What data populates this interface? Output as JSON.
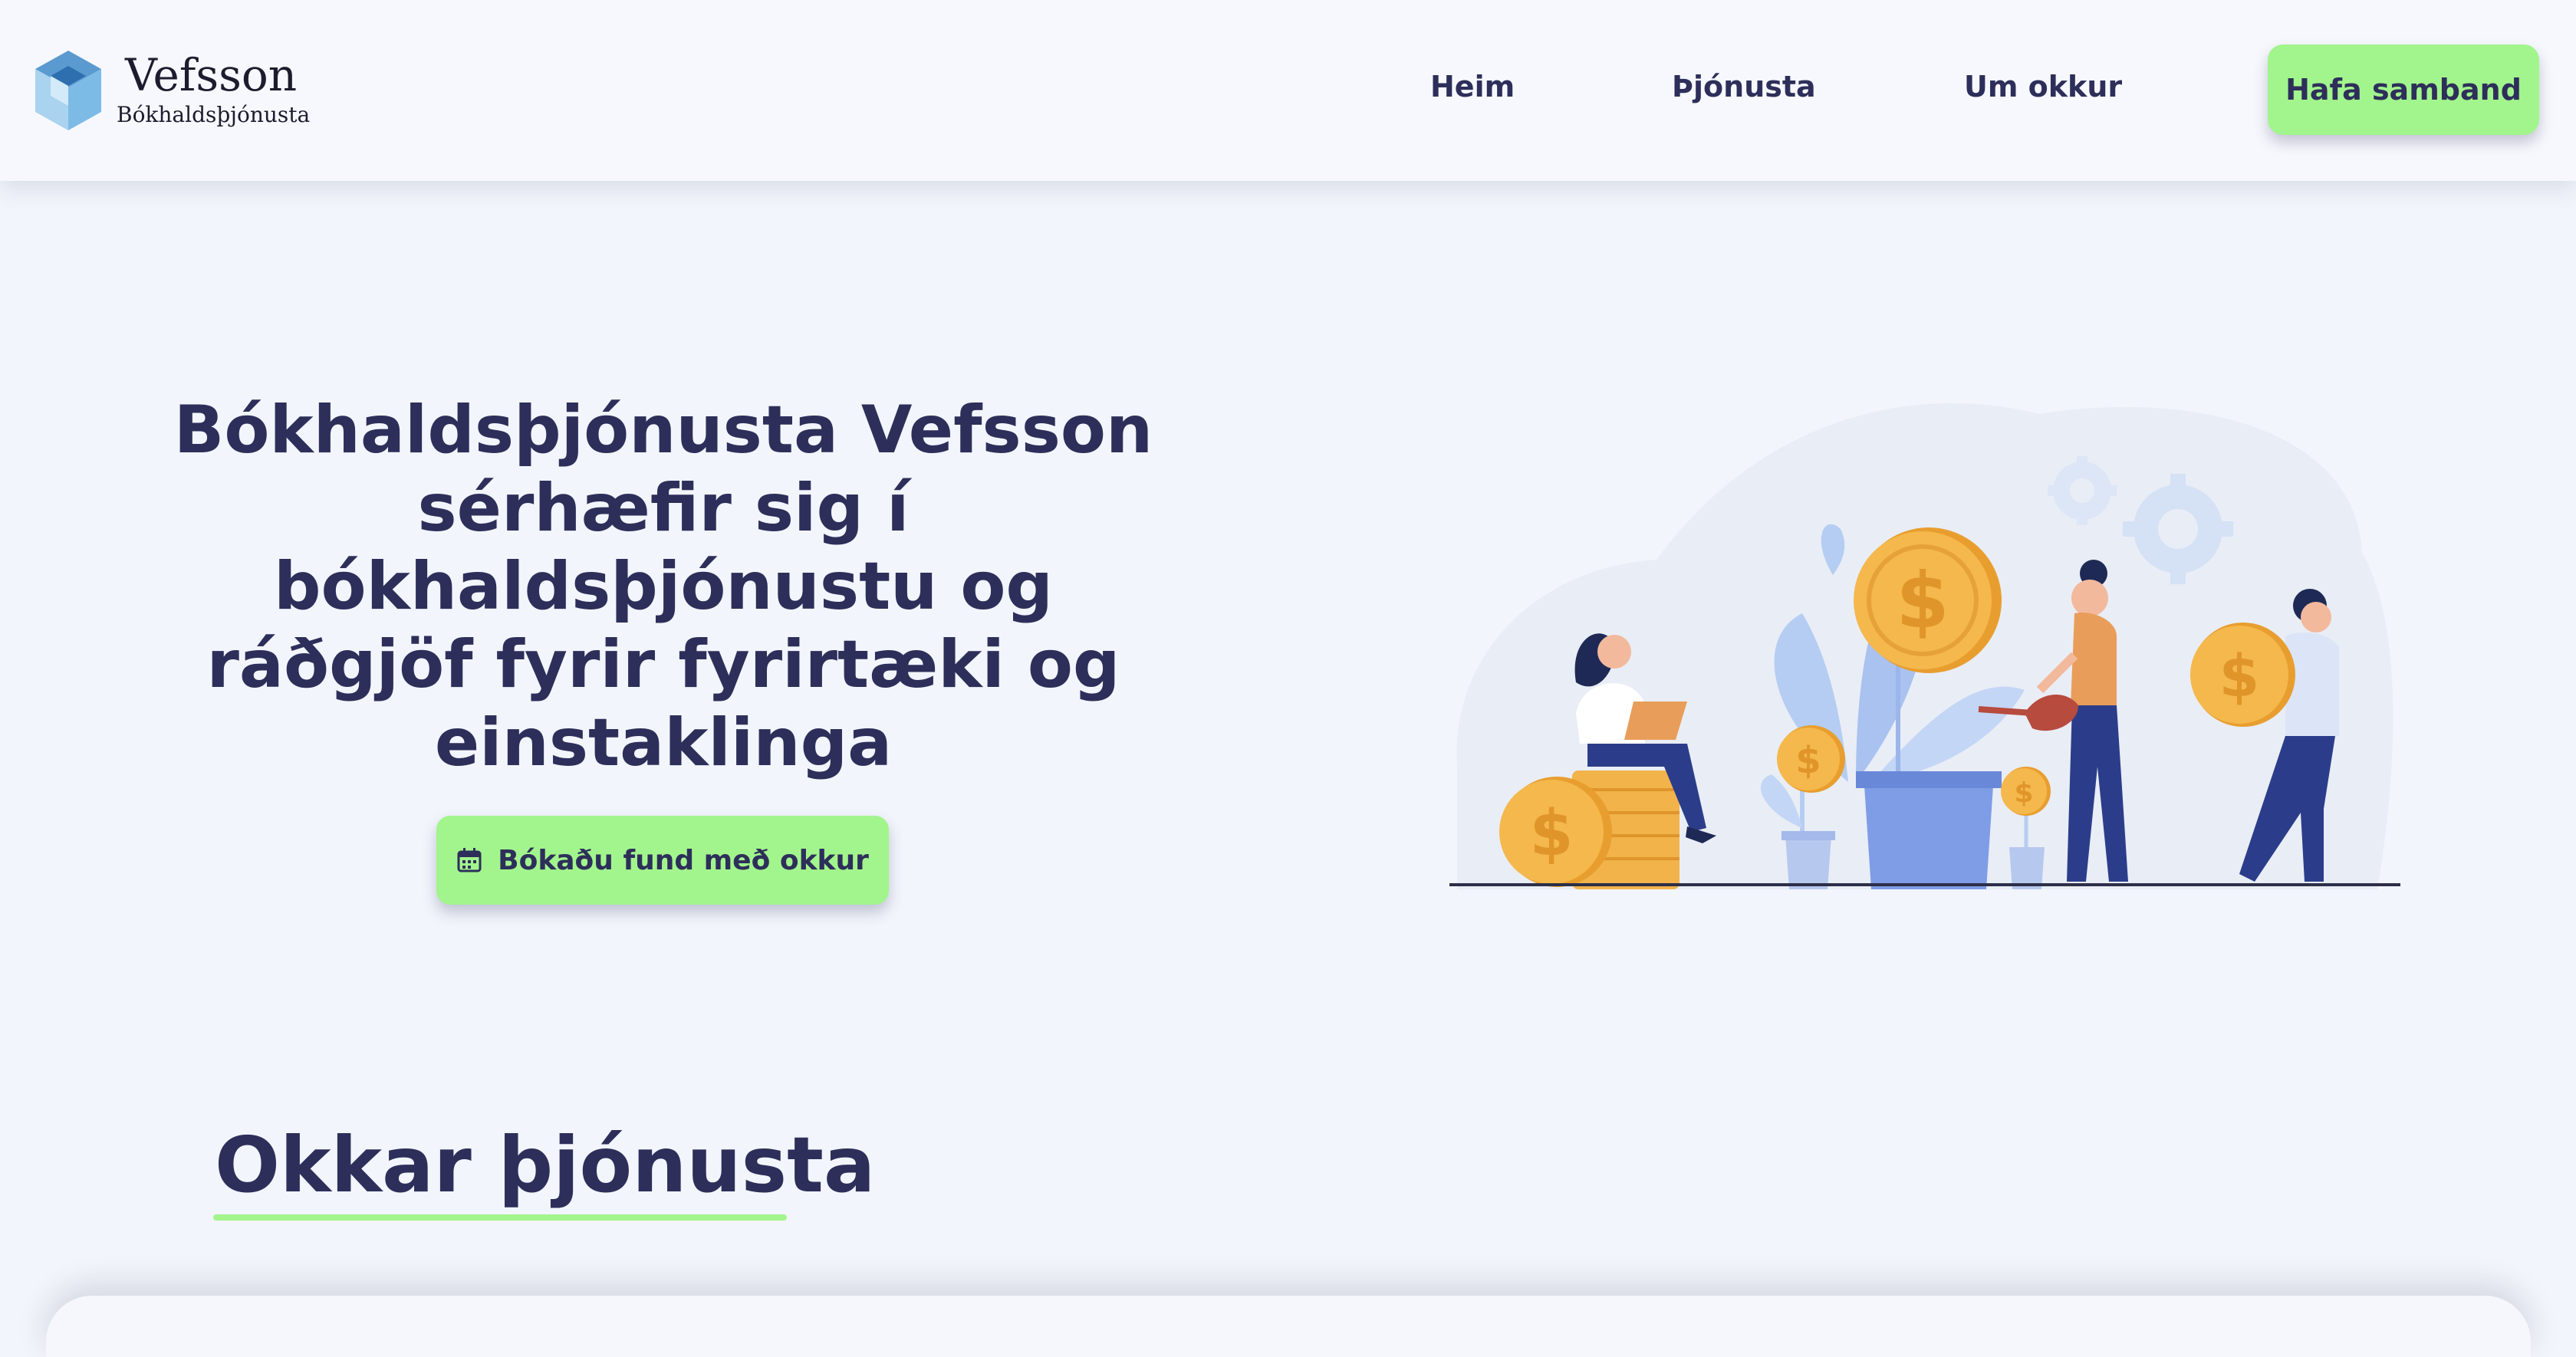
{
  "brand": {
    "name": "Vefsson",
    "tagline": "Bókhaldsþjónusta"
  },
  "nav": {
    "items": [
      {
        "label": "Heim"
      },
      {
        "label": "Þjónusta"
      },
      {
        "label": "Um okkur"
      }
    ],
    "cta_label": "Hafa samband"
  },
  "hero": {
    "title": "Bókhaldsþjónusta Vefsson sérhæfir sig í bókhaldsþjónustu og ráðgjöf fyrir fyrirtæki og einstaklinga",
    "button_label": "Bókaðu fund með okkur",
    "button_icon": "calendar-icon"
  },
  "services": {
    "heading": "Okkar þjónusta"
  },
  "colors": {
    "accent": "#a2f58c",
    "text_dark": "#2d2f5a",
    "background": "#f2f5fb",
    "header_bg": "#f7f8fd",
    "illustration_blue": "#7f9de6",
    "coin_gold": "#f1b34a"
  }
}
